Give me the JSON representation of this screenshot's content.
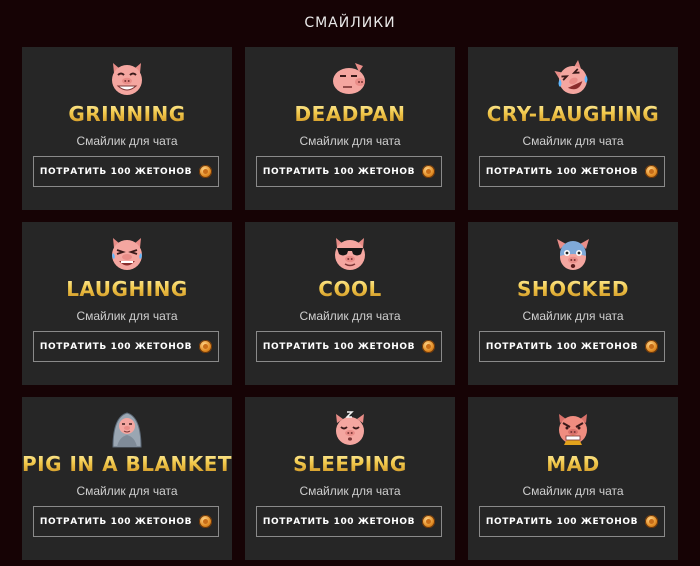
{
  "header": {
    "title": "СМАЙЛИКИ"
  },
  "cards": [
    {
      "icon": "grinning-pig-icon",
      "name": "GRINNING",
      "subtitle": "Смайлик для чата",
      "button_label": "ПОТРАТИТЬ 100 ЖЕТОНОВ"
    },
    {
      "icon": "deadpan-pig-icon",
      "name": "DEADPAN",
      "subtitle": "Смайлик для чата",
      "button_label": "ПОТРАТИТЬ 100 ЖЕТОНОВ"
    },
    {
      "icon": "cry-laughing-pig-icon",
      "name": "CRY-LAUGHING",
      "subtitle": "Смайлик для чата",
      "button_label": "ПОТРАТИТЬ 100 ЖЕТОНОВ"
    },
    {
      "icon": "laughing-pig-icon",
      "name": "LAUGHING",
      "subtitle": "Смайлик для чата",
      "button_label": "ПОТРАТИТЬ 100 ЖЕТОНОВ"
    },
    {
      "icon": "cool-pig-icon",
      "name": "COOL",
      "subtitle": "Смайлик для чата",
      "button_label": "ПОТРАТИТЬ 100 ЖЕТОНОВ"
    },
    {
      "icon": "shocked-pig-icon",
      "name": "SHOCKED",
      "subtitle": "Смайлик для чата",
      "button_label": "ПОТРАТИТЬ 100 ЖЕТОНОВ"
    },
    {
      "icon": "pig-in-a-blanket-icon",
      "name": "PIG IN A BLANKET",
      "subtitle": "Смайлик для чата",
      "button_label": "ПОТРАТИТЬ 100 ЖЕТОНОВ"
    },
    {
      "icon": "sleeping-pig-icon",
      "name": "SLEEPING",
      "subtitle": "Смайлик для чата",
      "button_label": "ПОТРАТИТЬ 100 ЖЕТОНОВ"
    },
    {
      "icon": "mad-pig-icon",
      "name": "MAD",
      "subtitle": "Смайлик для чата",
      "button_label": "ПОТРАТИТЬ 100 ЖЕТОНОВ"
    }
  ],
  "coin_icon": "token-coin-icon",
  "colors": {
    "background": "#160305",
    "card": "#262626",
    "title_gold": "#f2c94c",
    "pig_pink": "#f4a6a0"
  }
}
